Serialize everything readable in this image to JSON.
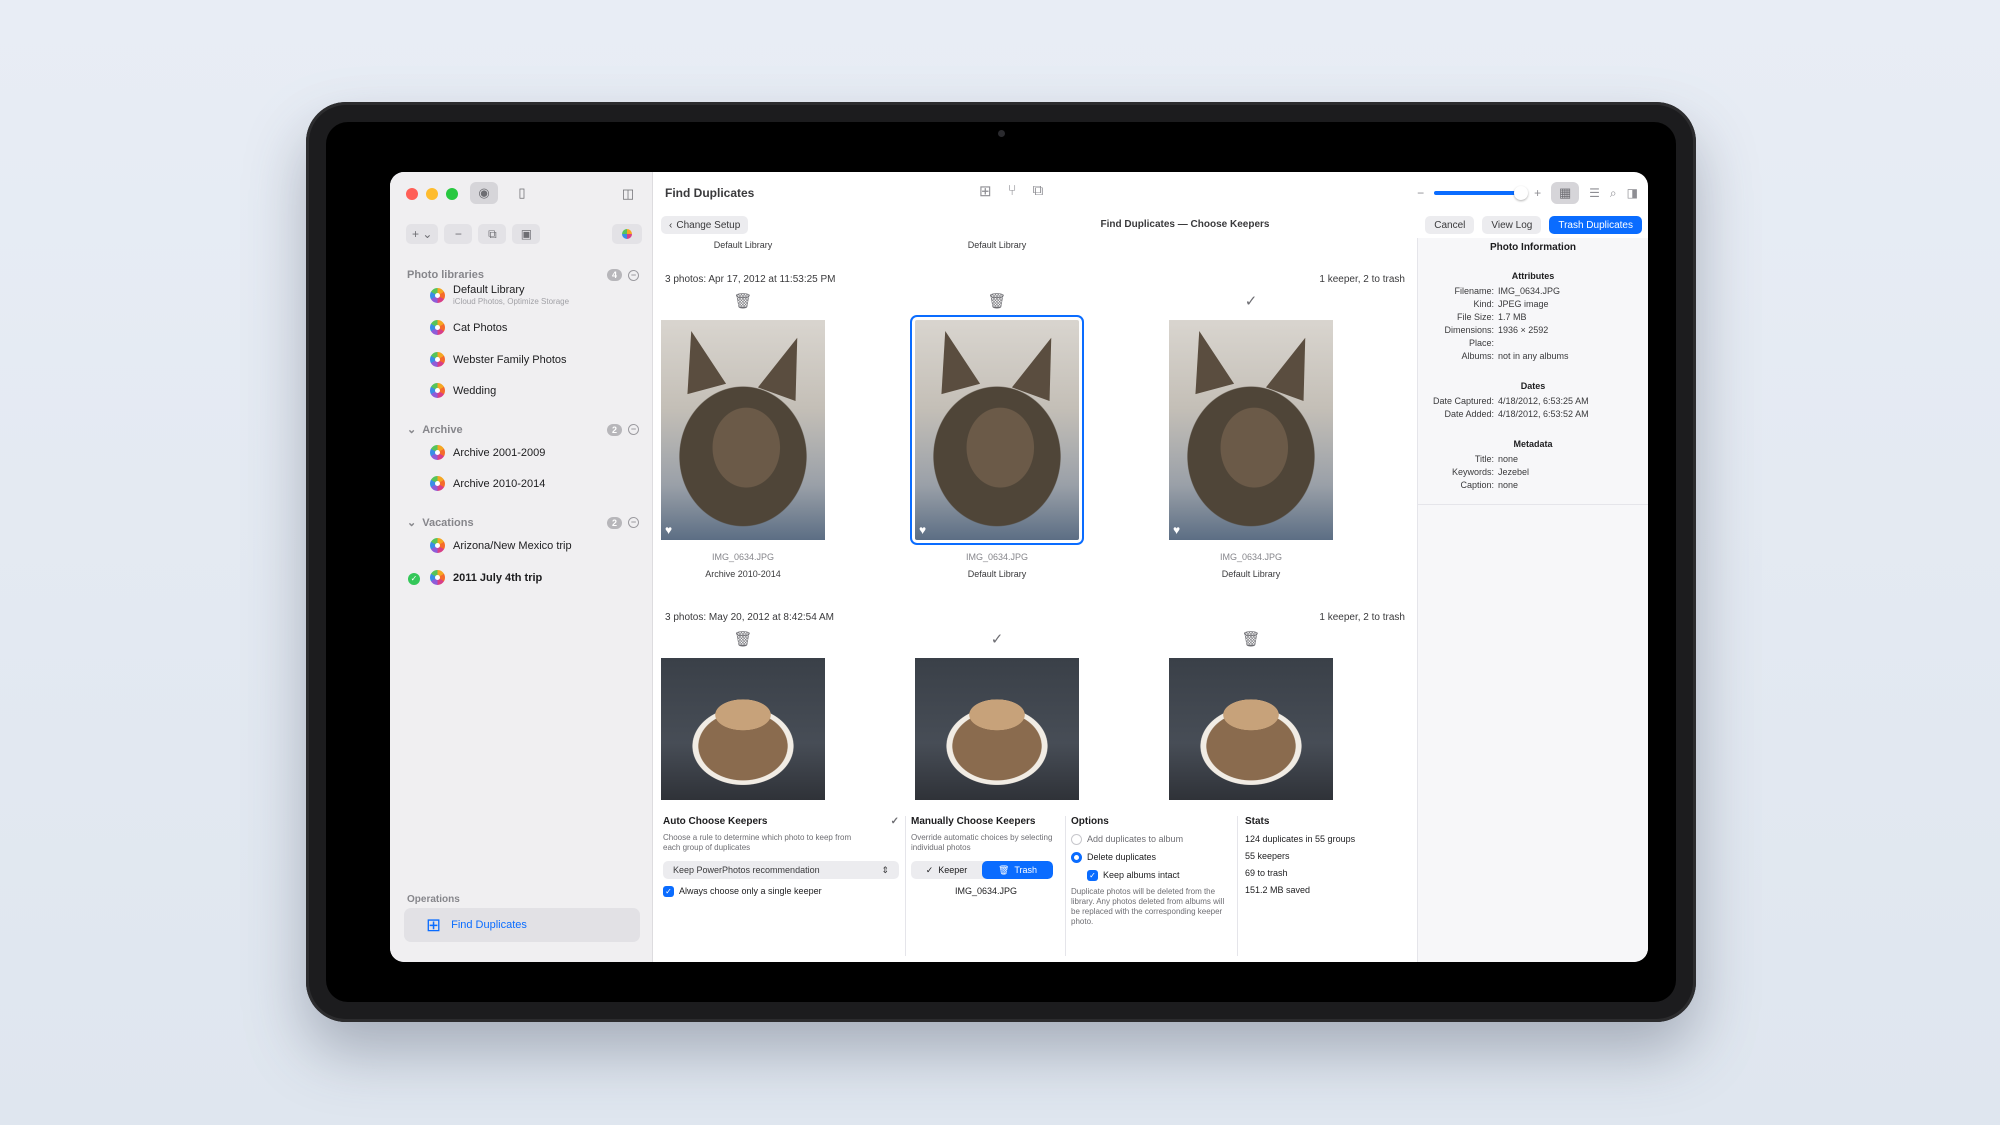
{
  "sidebar": {
    "sections": [
      {
        "title": "Photo libraries",
        "count": "4"
      },
      {
        "title": "Archive",
        "count": "2"
      },
      {
        "title": "Vacations",
        "count": "2"
      }
    ],
    "libraries": [
      {
        "name": "Default Library",
        "sub": "iCloud Photos, Optimize Storage"
      },
      {
        "name": "Cat Photos"
      },
      {
        "name": "Webster Family Photos"
      },
      {
        "name": "Wedding"
      },
      {
        "name": "Archive 2001-2009"
      },
      {
        "name": "Archive 2010-2014"
      },
      {
        "name": "Arizona/New Mexico trip"
      },
      {
        "name": "2011 July 4th trip"
      }
    ],
    "operations_label": "Operations",
    "operation": "Find Duplicates"
  },
  "toolbar": {
    "title": "Find Duplicates",
    "change_setup": "Change Setup",
    "subtitle": "Find Duplicates — Choose Keepers",
    "cancel": "Cancel",
    "view_log": "View Log",
    "trash_duplicates": "Trash Duplicates"
  },
  "content": {
    "top_labels": [
      "Default Library",
      "Default Library"
    ],
    "groups": [
      {
        "header": "3 photos: Apr 17, 2012 at 11:53:25 PM",
        "summary": "1 keeper, 2 to trash",
        "photos": [
          {
            "file": "IMG_0634.JPG",
            "library": "Archive 2010-2014",
            "mark": "trash-icon"
          },
          {
            "file": "IMG_0634.JPG",
            "library": "Default Library",
            "mark": "trash-icon"
          },
          {
            "file": "IMG_0634.JPG",
            "library": "Default Library",
            "mark": "check-icon"
          }
        ]
      },
      {
        "header": "3 photos: May 20, 2012 at 8:42:54 AM",
        "summary": "1 keeper, 2 to trash",
        "photos": [
          {
            "mark": "trash-icon"
          },
          {
            "mark": "check-icon"
          },
          {
            "mark": "trash-icon"
          }
        ]
      }
    ]
  },
  "panels": {
    "auto": {
      "title": "Auto Choose Keepers",
      "desc": "Choose a rule to determine which photo to keep from each group of duplicates",
      "rule": "Keep PowerPhotos recommendation",
      "single_keeper": "Always choose only a single keeper"
    },
    "manual": {
      "title": "Manually Choose Keepers",
      "desc": "Override automatic choices by selecting individual photos",
      "keeper": "Keeper",
      "trash": "Trash",
      "file": "IMG_0634.JPG"
    },
    "options": {
      "title": "Options",
      "add_to_album": "Add duplicates to album",
      "delete": "Delete duplicates",
      "keep_albums": "Keep albums intact",
      "note": "Duplicate photos will be deleted from the library. Any photos deleted from albums will be replaced with the corresponding keeper photo."
    },
    "stats": {
      "title": "Stats",
      "line1": "124 duplicates in 55 groups",
      "line2": "55 keepers",
      "line3": "69 to trash",
      "line4": "151.2 MB saved"
    }
  },
  "info": {
    "title": "Photo Information",
    "attributes_title": "Attributes",
    "attributes": [
      {
        "k": "Filename:",
        "v": "IMG_0634.JPG"
      },
      {
        "k": "Kind:",
        "v": "JPEG image"
      },
      {
        "k": "File Size:",
        "v": "1.7 MB"
      },
      {
        "k": "Dimensions:",
        "v": "1936 × 2592"
      },
      {
        "k": "Place:",
        "v": ""
      },
      {
        "k": "Albums:",
        "v": "not in any albums"
      }
    ],
    "dates_title": "Dates",
    "dates": [
      {
        "k": "Date Captured:",
        "v": "4/18/2012, 6:53:25 AM"
      },
      {
        "k": "Date Added:",
        "v": "4/18/2012, 6:53:52 AM"
      }
    ],
    "metadata_title": "Metadata",
    "metadata": [
      {
        "k": "Title:",
        "v": "none"
      },
      {
        "k": "Keywords:",
        "v": "Jezebel"
      },
      {
        "k": "Caption:",
        "v": "none"
      }
    ]
  }
}
